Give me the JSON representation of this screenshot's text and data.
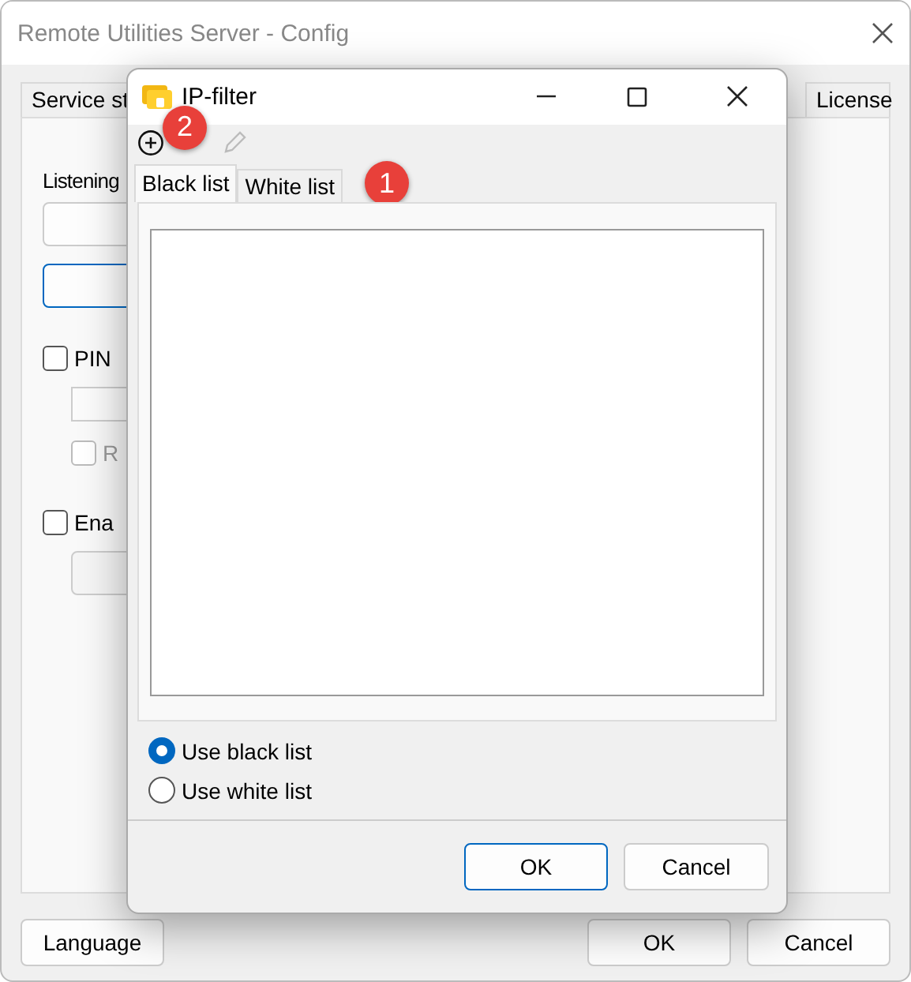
{
  "main_window": {
    "title": "Remote Utilities Server - Config",
    "tabs": [
      {
        "label": "Service st"
      },
      {
        "label": "License"
      }
    ],
    "panel": {
      "section_label": "Listening",
      "checkboxes": [
        {
          "label": "PIN",
          "checked": false,
          "disabled": false
        },
        {
          "label": "R",
          "checked": false,
          "disabled": true
        },
        {
          "label": "Ena",
          "checked": false,
          "disabled": false
        }
      ]
    },
    "buttons": [
      {
        "label": "Language"
      },
      {
        "label": "OK"
      },
      {
        "label": "Cancel"
      }
    ]
  },
  "dialog": {
    "title": "IP-filter",
    "toolbar": [
      {
        "kind": "add",
        "disabled": false
      },
      {
        "kind": "edit",
        "disabled": true
      }
    ],
    "toolbar_marker": "2",
    "tabs": [
      {
        "label": "Black list",
        "selected": true
      },
      {
        "label": "White list",
        "selected": false
      }
    ],
    "tabs_marker": "1",
    "radios": [
      {
        "label": "Use black list",
        "selected": true
      },
      {
        "label": "Use white list",
        "selected": false
      }
    ],
    "buttons": [
      {
        "label": "OK",
        "default": true
      },
      {
        "label": "Cancel",
        "default": false
      }
    ]
  }
}
